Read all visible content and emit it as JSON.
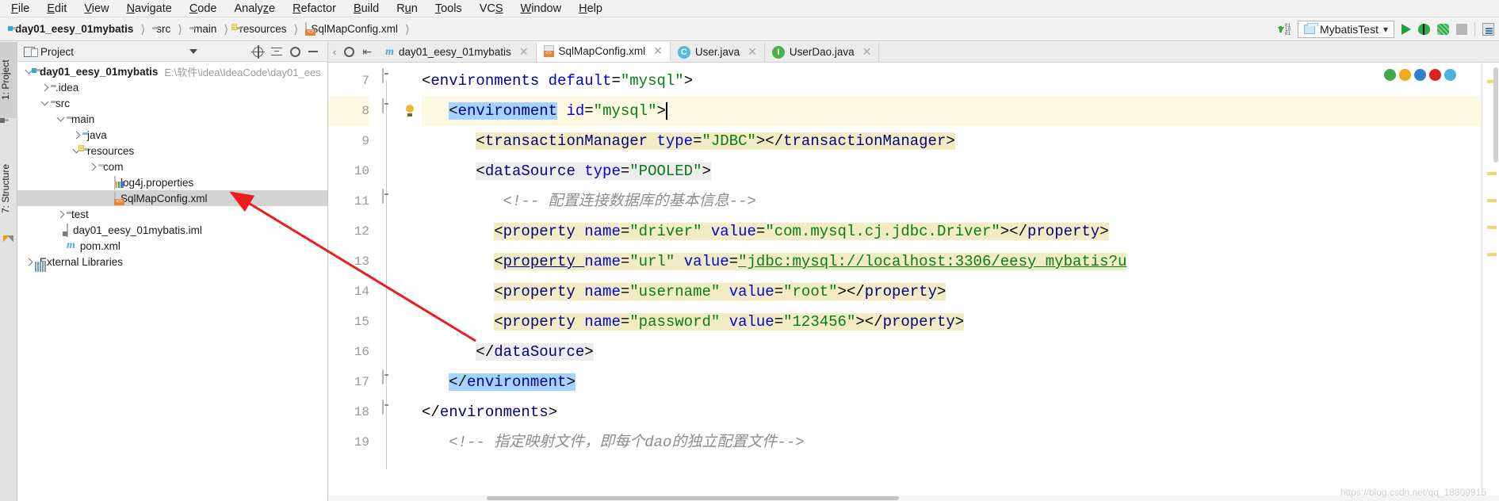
{
  "app": {
    "menu": [
      "File",
      "Edit",
      "View",
      "Navigate",
      "Code",
      "Analyze",
      "Refactor",
      "Build",
      "Run",
      "Tools",
      "VCS",
      "Window",
      "Help"
    ]
  },
  "breadcrumb": [
    {
      "label": "day01_eesy_01mybatis",
      "icon": "module-folder-icon",
      "bold": true
    },
    {
      "label": "src",
      "icon": "folder-icon",
      "bold": false
    },
    {
      "label": "main",
      "icon": "folder-icon",
      "bold": false
    },
    {
      "label": "resources",
      "icon": "resources-folder-icon",
      "bold": false
    },
    {
      "label": "SqlMapConfig.xml",
      "icon": "xml-file-icon",
      "bold": false
    }
  ],
  "toolbar": {
    "run_config": "MybatisTest",
    "run_icon": "run-icon",
    "debug_icon": "debug-icon",
    "coverage_icon": "run-with-coverage-icon",
    "stop_icon": "stop-icon",
    "database_icon": "database-icon",
    "updating_icon": "update-indices-icon"
  },
  "left_strip": {
    "project_tab": "1: Project",
    "structure_tab": "7: Structure"
  },
  "project_panel": {
    "title": "Project",
    "tree": [
      {
        "label": "day01_eesy_01mybatis",
        "path": "E:\\软件\\idea\\IdeaCode\\day01_ees",
        "indent": 0,
        "twisty": "down",
        "icon": "module-folder-icon",
        "bold": true,
        "selected": false
      },
      {
        "label": ".idea",
        "path": "",
        "indent": 1,
        "twisty": "right",
        "icon": "folder-icon",
        "bold": false,
        "selected": false
      },
      {
        "label": "src",
        "path": "",
        "indent": 1,
        "twisty": "down",
        "icon": "folder-icon",
        "bold": false,
        "selected": false
      },
      {
        "label": "main",
        "path": "",
        "indent": 2,
        "twisty": "down",
        "icon": "folder-icon",
        "bold": false,
        "selected": false
      },
      {
        "label": "java",
        "path": "",
        "indent": 3,
        "twisty": "right",
        "icon": "sources-folder-icon",
        "bold": false,
        "selected": false
      },
      {
        "label": "resources",
        "path": "",
        "indent": 3,
        "twisty": "down",
        "icon": "resources-folder-icon",
        "bold": false,
        "selected": false
      },
      {
        "label": "com",
        "path": "",
        "indent": 4,
        "twisty": "right",
        "icon": "package-folder-icon",
        "bold": false,
        "selected": false
      },
      {
        "label": "log4j.properties",
        "path": "",
        "indent": 5,
        "twisty": "none",
        "icon": "properties-file-icon",
        "bold": false,
        "selected": false
      },
      {
        "label": "SqlMapConfig.xml",
        "path": "",
        "indent": 5,
        "twisty": "none",
        "icon": "xml-file-icon",
        "bold": false,
        "selected": true
      },
      {
        "label": "test",
        "path": "",
        "indent": 2,
        "twisty": "right",
        "icon": "folder-icon",
        "bold": false,
        "selected": false
      },
      {
        "label": "day01_eesy_01mybatis.iml",
        "path": "",
        "indent": 2,
        "twisty": "none",
        "icon": "iml-file-icon",
        "bold": false,
        "selected": false
      },
      {
        "label": "pom.xml",
        "path": "",
        "indent": 2,
        "twisty": "none",
        "icon": "maven-file-icon",
        "bold": false,
        "selected": false
      },
      {
        "label": "External Libraries",
        "path": "",
        "indent": 0,
        "twisty": "right",
        "icon": "library-icon",
        "bold": false,
        "selected": false
      }
    ]
  },
  "editor": {
    "tabs": [
      {
        "label": "day01_eesy_01mybatis",
        "icon": "maven-module-icon",
        "active": false
      },
      {
        "label": "SqlMapConfig.xml",
        "icon": "xml-file-icon",
        "active": true
      },
      {
        "label": "User.java",
        "icon": "java-class-icon",
        "active": false
      },
      {
        "label": "UserDao.java",
        "icon": "java-interface-icon",
        "active": false
      }
    ],
    "line_numbers": [
      "7",
      "8",
      "9",
      "10",
      "11",
      "12",
      "13",
      "14",
      "15",
      "16",
      "17",
      "18",
      "19"
    ],
    "lines": [
      {
        "num": "7",
        "text": "<environments default=\"mysql\">"
      },
      {
        "num": "8",
        "text": "<environment id=\"mysql\">"
      },
      {
        "num": "9",
        "text": "<transactionManager type=\"JDBC\"></transactionManager>"
      },
      {
        "num": "10",
        "text": "<dataSource type=\"POOLED\">"
      },
      {
        "num": "11",
        "text": "<!-- 配置连接数据库的基本信息-->"
      },
      {
        "num": "12",
        "text": "<property name=\"driver\" value=\"com.mysql.cj.jdbc.Driver\"></property>"
      },
      {
        "num": "13",
        "text": "<property name=\"url\" value=\"jdbc:mysql://localhost:3306/eesy_mybatis?u"
      },
      {
        "num": "14",
        "text": "<property name=\"username\" value=\"root\"></property>"
      },
      {
        "num": "15",
        "text": "<property name=\"password\" value=\"123456\"></property>"
      },
      {
        "num": "16",
        "text": "</dataSource>"
      },
      {
        "num": "17",
        "text": "</environment>"
      },
      {
        "num": "18",
        "text": "</environments>"
      },
      {
        "num": "19",
        "text": "<!-- 指定映射文件，即每个dao的独立配置文件-->"
      }
    ],
    "browser_icons": [
      "chrome-icon",
      "chrome-canary-icon",
      "firefox-icon",
      "opera-icon",
      "edge-icon"
    ],
    "intention_bulb": "intention-bulb-icon"
  },
  "watermark": "https://blog.csdn.net/qq_18809915",
  "colors": {
    "tag": "#000082",
    "attribute": "#0000d8",
    "value": "#067d17",
    "comment": "#8c8c8c",
    "selection": "#a6d2ff",
    "highlight": "#fdfae3",
    "annotation_arrow": "#ee1c1c"
  }
}
